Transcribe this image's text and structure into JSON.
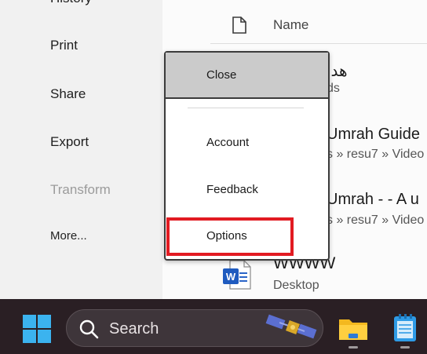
{
  "left_nav": {
    "items": [
      {
        "label": "History"
      },
      {
        "label": "Print"
      },
      {
        "label": "Share"
      },
      {
        "label": "Export"
      },
      {
        "label": "Transform"
      },
      {
        "label": "More..."
      }
    ]
  },
  "files": {
    "column_name": "Name",
    "rows": [
      {
        "title": "هدا",
        "path": "ds"
      },
      {
        "title": "Umrah Guide",
        "path": "s » resu7 » Video"
      },
      {
        "title": "Umrah -  - A u",
        "path": "s » resu7 » Video"
      },
      {
        "title": "WWWW",
        "path": "Desktop"
      }
    ]
  },
  "menu": {
    "items": [
      {
        "label": "Close"
      },
      {
        "label": "Account"
      },
      {
        "label": "Feedback"
      },
      {
        "label": "Options"
      }
    ]
  },
  "taskbar": {
    "search_label": "Search",
    "icons": [
      "windows-start-icon",
      "search-icon",
      "satellite-icon",
      "file-explorer-icon",
      "notepad-icon"
    ]
  },
  "colors": {
    "highlight": "#e21b22",
    "taskbar": "#2a1f24"
  }
}
